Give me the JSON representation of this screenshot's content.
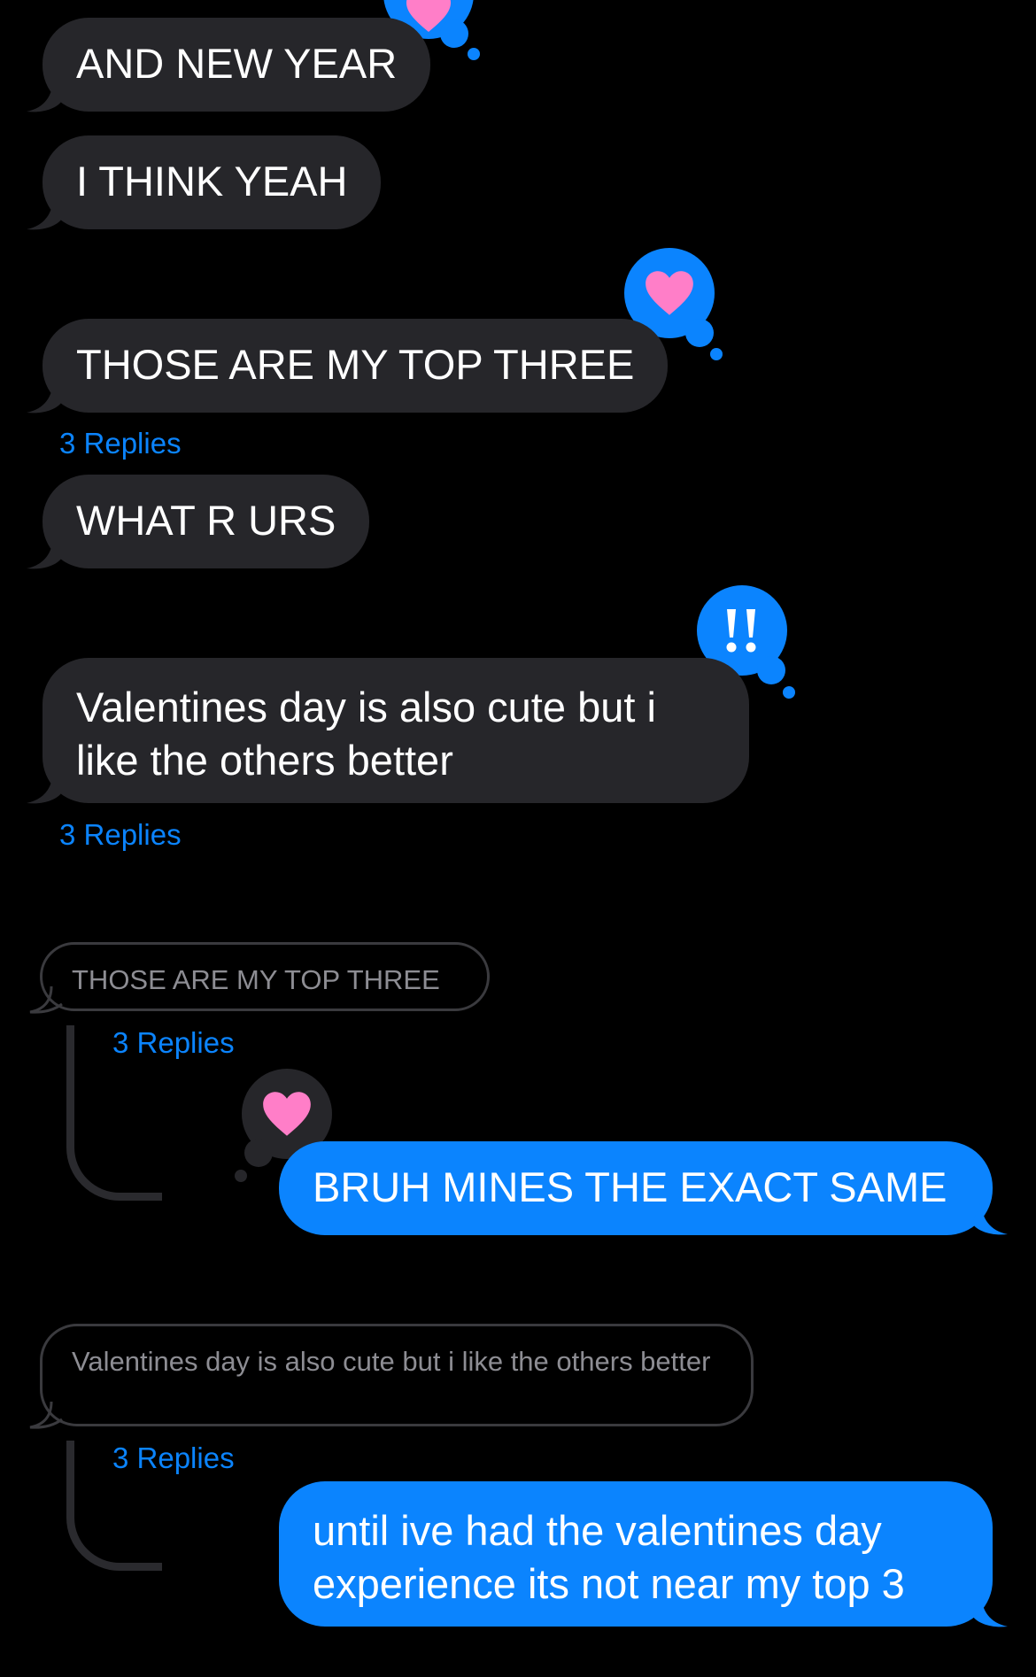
{
  "messages": {
    "m1": "AND NEW YEAR",
    "m2": "I THINK YEAH",
    "m3": "THOSE ARE MY TOP THREE",
    "m4": "WHAT R URS",
    "m5": "Valentines day is also cute but i like the others better",
    "m6": "BRUH MINES THE EXACT SAME",
    "m7": "until ive had the valentines day experience its not near my top 3"
  },
  "replies": {
    "r1": "3 Replies",
    "r2": "3 Replies",
    "r3": "3 Replies",
    "r4": "3 Replies"
  },
  "quotes": {
    "q1": "THOSE ARE MY TOP THREE",
    "q2": "Valentines day is also cute but i like the others better"
  },
  "tapbacks": {
    "t1": "heart",
    "t2": "exclamation",
    "t3": "heart"
  },
  "colors": {
    "background": "#000000",
    "incoming_bubble": "#26262a",
    "outgoing_bubble": "#0b84fe",
    "link": "#0b84fe",
    "heart": "#ff7ec8"
  }
}
